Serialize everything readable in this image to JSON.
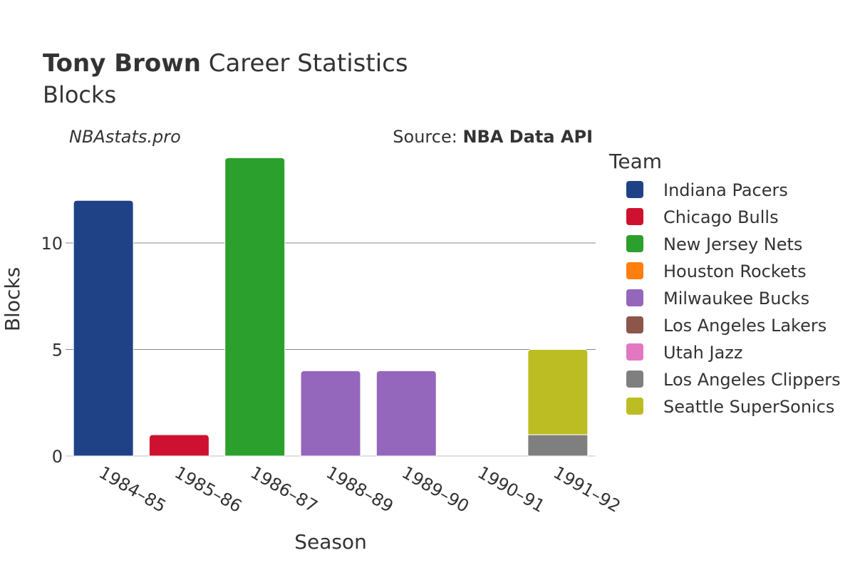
{
  "title": {
    "bold": "Tony Brown",
    "rest": " Career Statistics",
    "subtitle": "Blocks"
  },
  "watermark": "NBAstats.pro",
  "source": {
    "prefix": "Source: ",
    "name": "NBA Data API"
  },
  "legend_title": "Team",
  "chart_data": {
    "type": "bar",
    "stacked": true,
    "title": "Tony Brown Career Statistics Blocks",
    "xlabel": "Season",
    "ylabel": "Blocks",
    "ylim": [
      0,
      14.7
    ],
    "yticks": [
      0,
      5,
      10
    ],
    "grid": true,
    "legend_position": "right",
    "categories": [
      "1984–85",
      "1985–86",
      "1986–87",
      "1988–89",
      "1989–90",
      "1990–91",
      "1991–92"
    ],
    "series": [
      {
        "name": "Indiana Pacers",
        "color": "#1f4287",
        "values": [
          12,
          0,
          0,
          0,
          0,
          0,
          0
        ]
      },
      {
        "name": "Chicago Bulls",
        "color": "#ce1130",
        "values": [
          0,
          1,
          0,
          0,
          0,
          0,
          0
        ]
      },
      {
        "name": "New Jersey Nets",
        "color": "#2ca02c",
        "values": [
          0,
          0,
          14,
          0,
          0,
          0,
          0
        ]
      },
      {
        "name": "Houston Rockets",
        "color": "#ff7f0e",
        "values": [
          0,
          0,
          0,
          0,
          0,
          0,
          0
        ]
      },
      {
        "name": "Milwaukee Bucks",
        "color": "#9467bd",
        "values": [
          0,
          0,
          0,
          4,
          4,
          0,
          0
        ]
      },
      {
        "name": "Los Angeles Lakers",
        "color": "#8c564b",
        "values": [
          0,
          0,
          0,
          0,
          0,
          0,
          0
        ]
      },
      {
        "name": "Utah Jazz",
        "color": "#e377c2",
        "values": [
          0,
          0,
          0,
          0,
          0,
          0,
          0
        ]
      },
      {
        "name": "Los Angeles Clippers",
        "color": "#7f7f7f",
        "values": [
          0,
          0,
          0,
          0,
          0,
          0,
          1
        ]
      },
      {
        "name": "Seattle SuperSonics",
        "color": "#bcbd22",
        "values": [
          0,
          0,
          0,
          0,
          0,
          0,
          4
        ]
      }
    ]
  }
}
